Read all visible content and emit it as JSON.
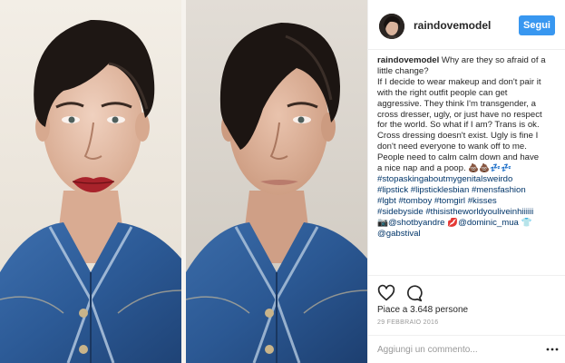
{
  "post": {
    "username": "raindovemodel",
    "follow_label": "Segui"
  },
  "caption": {
    "user": "raindovemodel",
    "lines": [
      " Why are they so afraid of a",
      "little change?",
      "If I decide to wear makeup and don't pair it",
      "with the right outfit people can get",
      "aggressive. They think I'm transgender, a",
      "cross dresser, ugly, or just have no respect",
      "for the world. So what if I am? Trans is ok.",
      "Cross dressing doesn't exist. Ugly is fine I",
      "don't need everyone to wank off to me.",
      "People need to calm calm down and have",
      "a nice nap and a poop. 💩💩💤💤"
    ],
    "tags": [
      "#stopaskingaboutmygenitalsweirdo",
      "#lipstick #lipsticklesbian #mensfashion",
      "#lgbt #tomboy #tomgirl #kisses",
      "#sidebyside #thisistheworldyouliveinhiiiiii",
      "📷@shotbyandre 💋@dominic_mua 👕",
      "@gabstival"
    ]
  },
  "likes_text": "Piace a 3.648 persone",
  "date_text": "29 FEBBRAIO 2016",
  "comment_placeholder": "Aggiungi un commento...",
  "colors": {
    "accent": "#3897f0",
    "hashtag": "#003569",
    "denim": "#2f5f9a"
  },
  "icons": [
    "heart-icon",
    "comment-icon",
    "more-options-icon"
  ]
}
